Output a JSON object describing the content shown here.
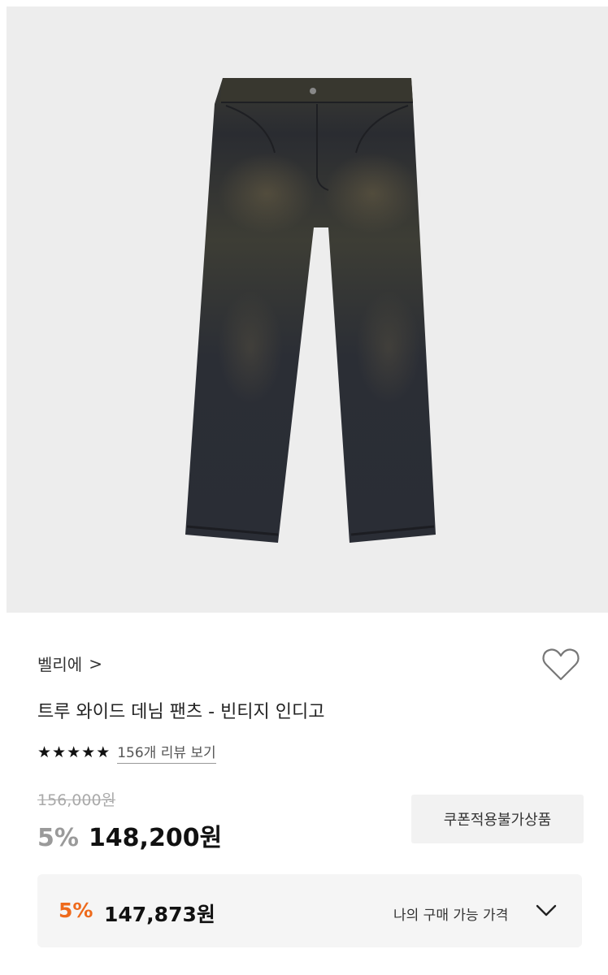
{
  "product": {
    "image_alt": "트루 와이드 데님 팬츠 - 빈티지 인디고",
    "brand": "벨리에",
    "brand_chevron": ">",
    "title": "트루 와이드 데님 팬츠 - 빈티지 인디고",
    "rating_stars": 5,
    "review_link": "156개 리뷰 보기"
  },
  "pricing": {
    "original_price": "156,000원",
    "discount_rate": "5%",
    "sale_price": "148,200원",
    "coupon_badge": "쿠폰적용불가상품",
    "my_price": {
      "discount_rate": "5%",
      "price": "147,873원",
      "label": "나의 구매 가능 가격"
    }
  },
  "colors": {
    "image_background": "#ededed",
    "accent_orange": "#ee6a1c",
    "muted_discount": "#9a9a9a",
    "denim_dark": "#2a2d33"
  },
  "icons": {
    "like": "heart-outline-icon",
    "expand": "chevron-down-icon",
    "rating": "star-icon"
  }
}
